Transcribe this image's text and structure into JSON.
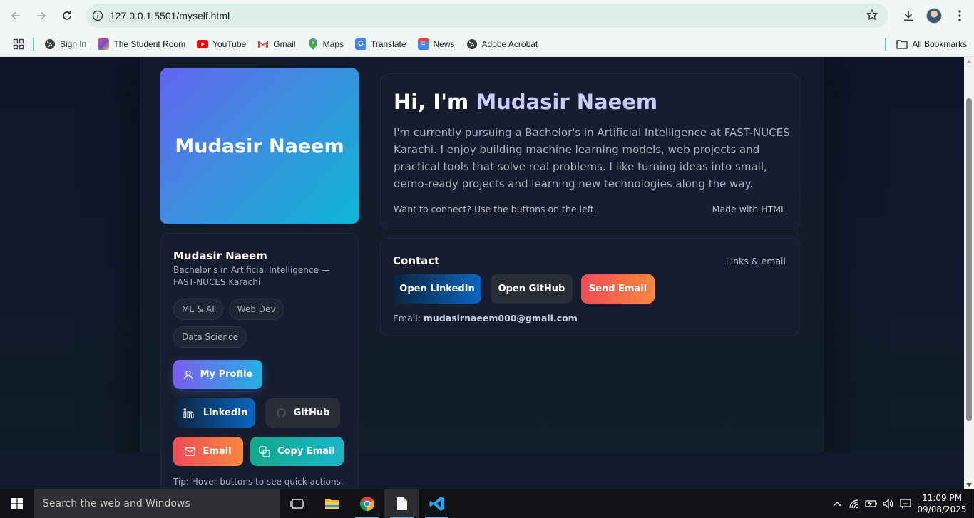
{
  "browser": {
    "url": "127.0.0.1:5501/myself.html",
    "bookmarks": [
      {
        "label": "Sign In",
        "icon": "globe-icon"
      },
      {
        "label": "The Student Room",
        "icon": "tsr-icon"
      },
      {
        "label": "YouTube",
        "icon": "youtube-icon"
      },
      {
        "label": "Gmail",
        "icon": "gmail-icon"
      },
      {
        "label": "Maps",
        "icon": "maps-icon"
      },
      {
        "label": "Translate",
        "icon": "translate-icon"
      },
      {
        "label": "News",
        "icon": "news-icon"
      },
      {
        "label": "Adobe Acrobat",
        "icon": "globe-icon"
      }
    ],
    "all_bookmarks": "All Bookmarks"
  },
  "page": {
    "hero_name": "Mudasir Naeem",
    "profile": {
      "name": "Mudasir Naeem",
      "subtitle": "Bachelor's in Artificial Intelligence — FAST-NUCES Karachi",
      "tags": [
        "ML & AI",
        "Web Dev",
        "Data Science"
      ]
    },
    "buttons": {
      "my_profile": "My Profile",
      "linkedin": "LinkedIn",
      "github": "GitHub",
      "email": "Email",
      "copy_email": "Copy Email"
    },
    "tip": "Tip: Hover buttons to see quick actions.",
    "intro": {
      "greeting": "Hi, I'm",
      "name": "Mudasir Naeem",
      "body": "I'm currently pursuing a Bachelor's in Artificial Intelligence at FAST-NUCES Karachi. I enjoy building machine learning models, web projects and practical tools that solve real problems. I like turning ideas into small, demo-ready projects and learning new technologies along the way.",
      "cta": "Want to connect? Use the buttons on the left.",
      "made_with": "Made with HTML"
    },
    "contact": {
      "title": "Contact",
      "links_label": "Links & email",
      "open_linkedin": "Open LinkedIn",
      "open_github": "Open GitHub",
      "send_email": "Send Email",
      "email_label": "Email:",
      "email_value": "mudasirnaeem000@gmail.com"
    }
  },
  "taskbar": {
    "search_placeholder": "Search the web and Windows",
    "time": "11:09 PM",
    "date": "09/08/2025"
  },
  "colors": {
    "accent_purple": "#6264ef",
    "accent_cyan": "#0cb6d4",
    "linkedin_blue": "#0a66c2",
    "email_red": "#f04b55",
    "email_orange": "#f9873e",
    "copy_teal": "#10a98c",
    "page_bg": "#0f1629",
    "card_bg": "#161d2e"
  }
}
